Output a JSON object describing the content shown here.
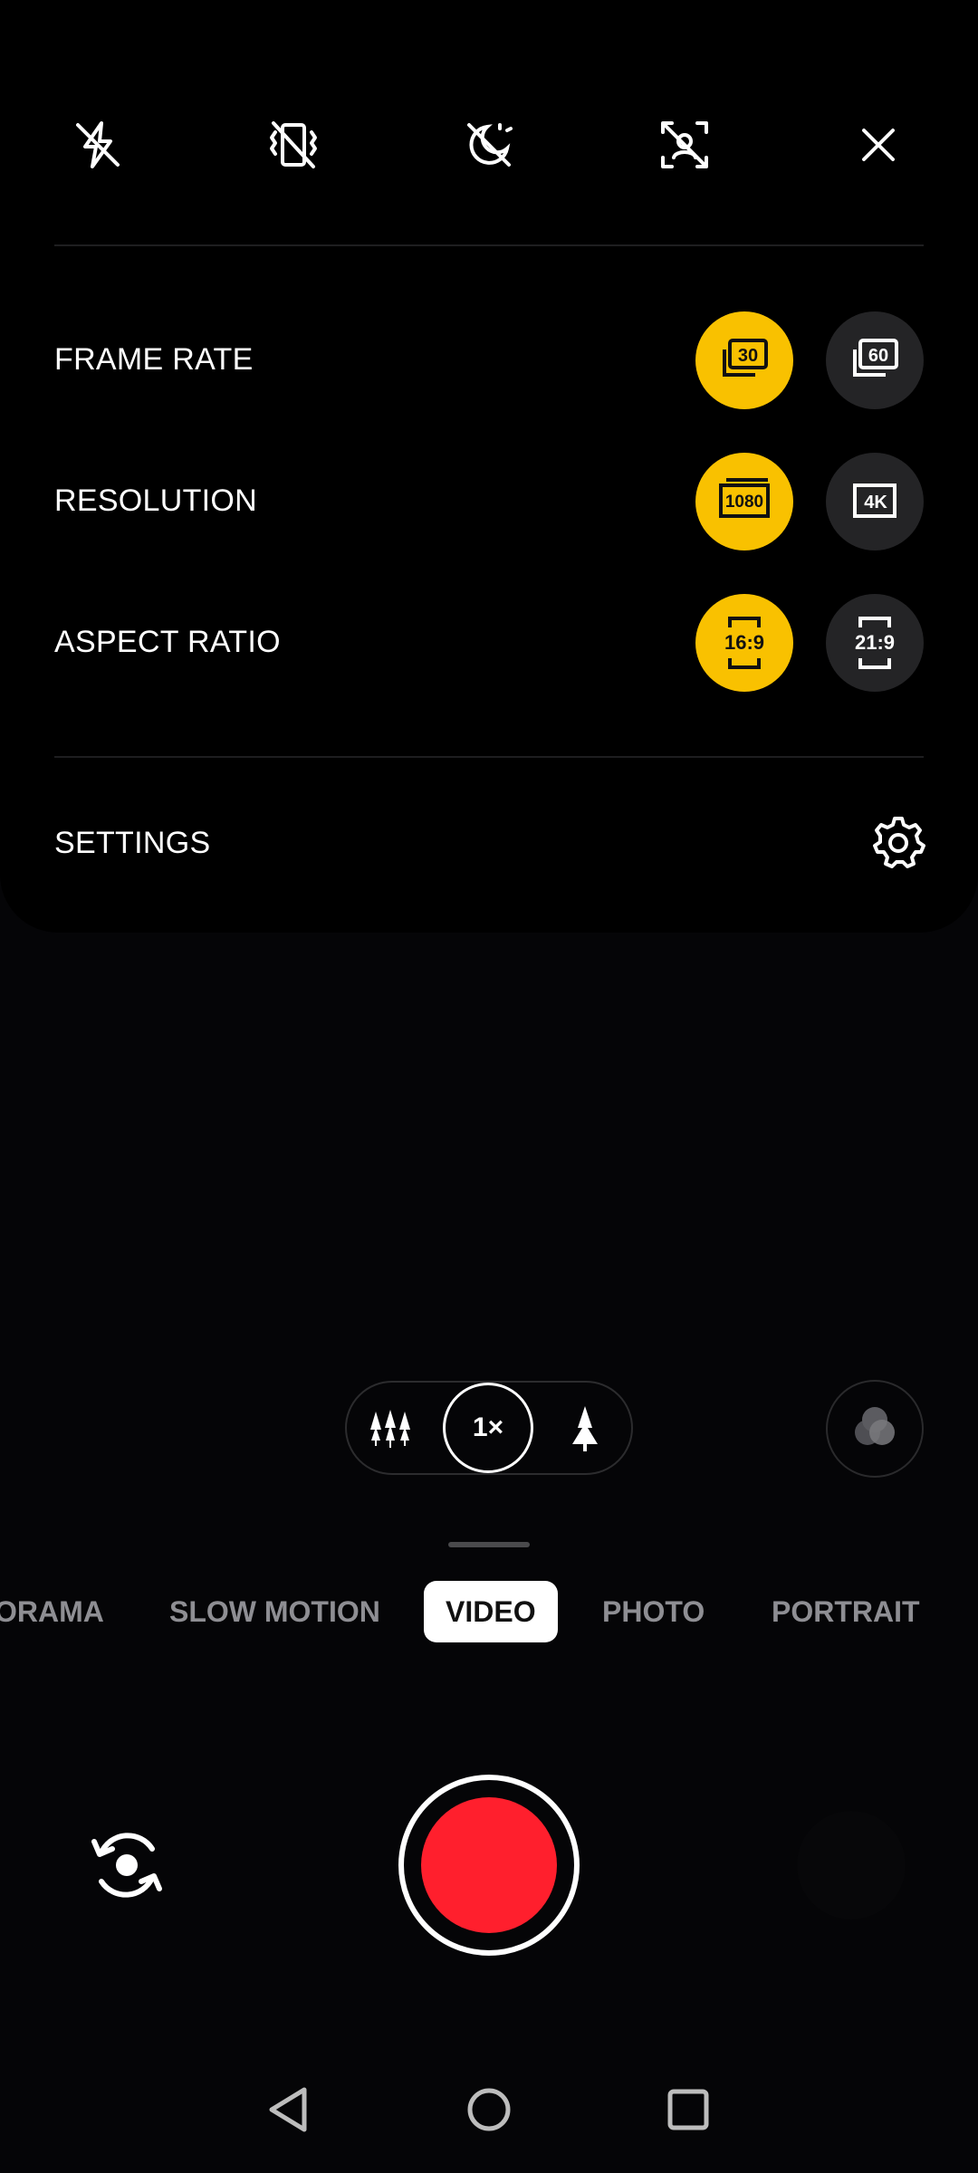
{
  "quick_settings": {
    "icons": [
      "flash-off-icon",
      "vibrate-off-icon",
      "night-off-icon",
      "face-detect-off-icon",
      "close-icon"
    ]
  },
  "options": {
    "frame_rate": {
      "label": "FRAME RATE",
      "choices": [
        "30",
        "60"
      ],
      "selected": "30"
    },
    "resolution": {
      "label": "RESOLUTION",
      "choices": [
        "1080",
        "4K"
      ],
      "selected": "1080"
    },
    "aspect_ratio": {
      "label": "ASPECT RATIO",
      "choices": [
        "16:9",
        "21:9"
      ],
      "selected": "16:9"
    }
  },
  "settings": {
    "label": "SETTINGS",
    "icon": "gear-icon"
  },
  "zoom": {
    "current": "1×",
    "wide_icon": "trees-icon",
    "tele_icon": "tree-icon"
  },
  "modes": {
    "items": [
      "ORAMA",
      "SLOW MOTION",
      "VIDEO",
      "PHOTO",
      "PORTRAIT"
    ],
    "active": "VIDEO"
  },
  "colors": {
    "accent": "#f9c100",
    "record": "#ff1f2d",
    "background": "#000000",
    "inactive_button": "#242426"
  }
}
